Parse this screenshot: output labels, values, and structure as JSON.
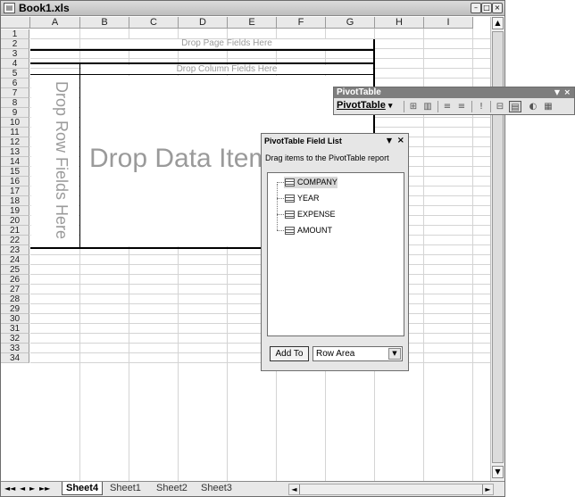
{
  "window": {
    "title": "Book1.xls",
    "sys_icon": "excel-doc-icon",
    "min_label": "–",
    "max_label": "□",
    "close_label": "×"
  },
  "columns": [
    "A",
    "B",
    "C",
    "D",
    "E",
    "F",
    "G",
    "H",
    "I"
  ],
  "rows": [
    "1",
    "2",
    "3",
    "4",
    "5",
    "6",
    "7",
    "8",
    "9",
    "10",
    "11",
    "12",
    "13",
    "14",
    "15",
    "16",
    "17",
    "18",
    "19",
    "20",
    "21",
    "22",
    "23",
    "24",
    "25",
    "26",
    "27",
    "28",
    "29",
    "30",
    "31",
    "32",
    "33",
    "34"
  ],
  "pivot_area": {
    "page_fields": "Drop Page Fields Here",
    "column_fields": "Drop Column Fields Here",
    "row_fields": "Drop Row Fields Here",
    "data_items": "Drop Data Items Here"
  },
  "sheet_tabs": {
    "nav": [
      "◄◄",
      "◄",
      "►",
      "►►"
    ],
    "tabs": [
      "Sheet4",
      "Sheet1",
      "Sheet2",
      "Sheet3"
    ],
    "active": "Sheet4"
  },
  "pivot_toolbar": {
    "title": "PivotTable",
    "menu_label": "PivotTable",
    "menu_arrow": "▾",
    "dropdown_arrow": "▼",
    "close_label": "×"
  },
  "field_list": {
    "title": "PivotTable Field List",
    "dropdown_arrow": "▼",
    "close_label": "×",
    "instruction": "Drag items to the PivotTable report",
    "fields": [
      "COMPANY",
      "YEAR",
      "EXPENSE",
      "AMOUNT"
    ],
    "selected_field": "COMPANY",
    "add_to_label": "Add To",
    "area_value": "Row Area",
    "area_arrow": "▼"
  },
  "colors": {
    "window_title_bg": "#c8c8c8",
    "toolbar_title_bg": "#7e7e7e",
    "panel_bg": "#e6e6e6",
    "hint_text": "#9a9a9a"
  }
}
